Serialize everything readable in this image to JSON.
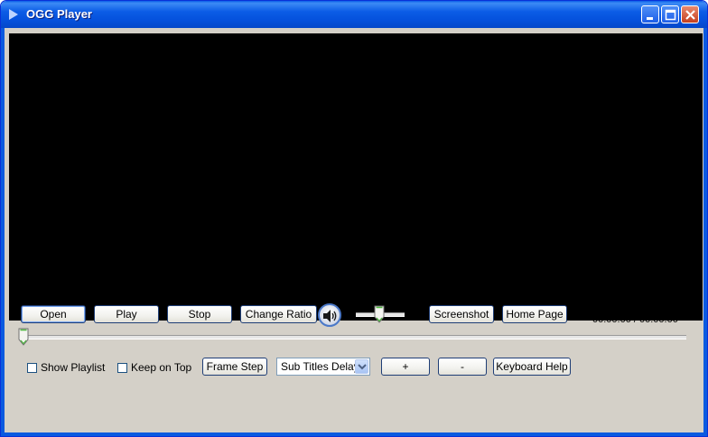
{
  "window": {
    "title": "OGG Player",
    "colors": {
      "titlebar": "#0551dd",
      "frame": "#0a5ae0",
      "video": "#000000",
      "panel": "#d4d0c8"
    }
  },
  "controls": {
    "open_label": "Open",
    "play_label": "Play",
    "stop_label": "Stop",
    "change_ratio_label": "Change Ratio",
    "screenshot_label": "Screenshot",
    "home_page_label": "Home Page",
    "time_readout": "00:00:00 / 00:00:00",
    "mute_icon": "speaker-icon"
  },
  "options": {
    "show_playlist_label": "Show Playlist",
    "show_playlist_checked": false,
    "keep_on_top_label": "Keep on Top",
    "keep_on_top_checked": false,
    "frame_step_label": "Frame Step",
    "subtitles_select": {
      "selected": "Sub Titles Delay"
    },
    "plus_label": "+",
    "minus_label": "-",
    "keyboard_help_label": "Keyboard Help"
  }
}
